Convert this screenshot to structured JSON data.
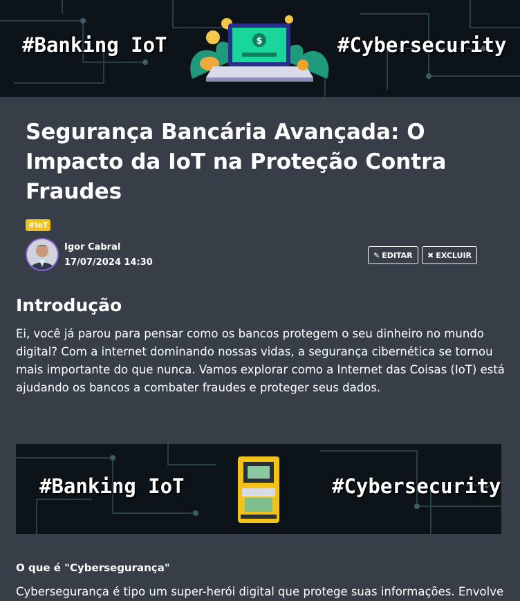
{
  "hero": {
    "left_hashtag": "#Banking IoT",
    "right_hashtag": "#Cybersecurity"
  },
  "article": {
    "title": "Segurança Bancária Avançada: O Impacto da IoT na Proteção Contra Fraudes",
    "tag": "#IoT",
    "author": "Igor Cabral",
    "date": "17/07/2024 14:30",
    "actions": {
      "edit_label": "EDITAR",
      "delete_label": "EXCLUIR",
      "edit_icon": "pencil-icon",
      "delete_icon": "close-icon"
    },
    "intro_heading": "Introdução",
    "intro_text": "Ei, você já parou para pensar como os bancos protegem o seu dinheiro no mundo digital? Com a internet dominando nossas vidas, a segurança cibernética se tornou mais importante do que nunca. Vamos explorar como a Internet das Coisas (IoT) está ajudando os bancos a combater fraudes e proteger seus dados.",
    "second_banner": {
      "left_hashtag": "#Banking IoT",
      "right_hashtag": "#Cybersecurity"
    },
    "section_heading": "O que é \"Cybersegurança\"",
    "section_text": "Cybersegurança é tipo um super-herói digital que protege suas informações. Envolve"
  },
  "colors": {
    "page_bg": "#373e48",
    "tag_bg": "#f2c21b",
    "avatar_ring": "#8a5bd6",
    "banner_bg": "#0d1419"
  }
}
